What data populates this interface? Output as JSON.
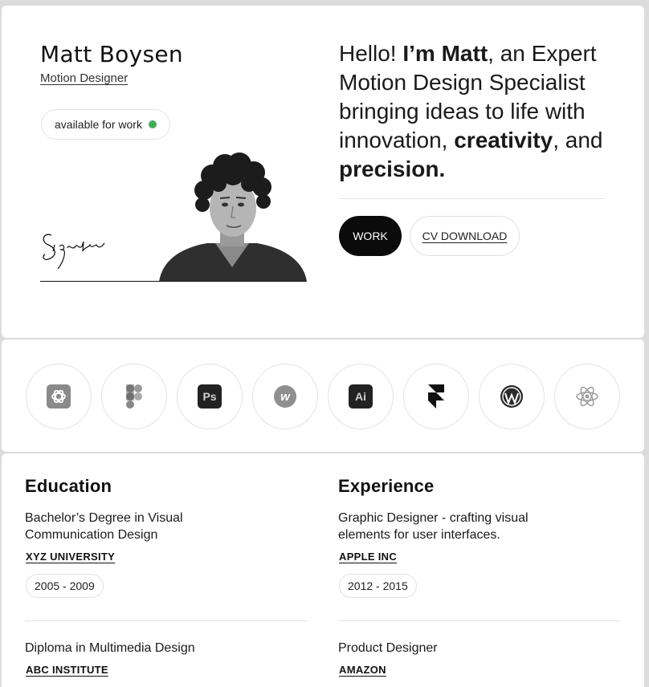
{
  "profile": {
    "name": "Matt Boysen",
    "role": "Motion Designer",
    "availability": "available for work",
    "status_color": "#3fae57"
  },
  "headline": {
    "p1": "Hello! ",
    "b1": "I’m Matt",
    "p2": ", an Expert Motion Design Specialist bringing ideas to life with innovation, ",
    "b2": "creativity",
    "p3": ", and ",
    "b3": "precision."
  },
  "actions": {
    "work_label": "WORK",
    "cv_label": "CV DOWNLOAD"
  },
  "tools": [
    {
      "icon": "chatgpt-icon"
    },
    {
      "icon": "figma-icon"
    },
    {
      "icon": "photoshop-icon",
      "label": "Ps"
    },
    {
      "icon": "webflow-icon",
      "label": "w"
    },
    {
      "icon": "illustrator-icon",
      "label": "Ai"
    },
    {
      "icon": "framer-icon"
    },
    {
      "icon": "wordpress-icon"
    },
    {
      "icon": "react-icon"
    }
  ],
  "education": {
    "title": "Education",
    "items": [
      {
        "degree": "Bachelor’s Degree in Visual Communication Design",
        "org": "XYZ UNIVERSITY",
        "years": "2005 - 2009"
      },
      {
        "degree": "Diploma in Multimedia Design",
        "org": "ABC INSTITUTE"
      }
    ]
  },
  "experience": {
    "title": "Experience",
    "items": [
      {
        "degree": "Graphic Designer - crafting visual elements for user interfaces.",
        "org": "APPLE INC",
        "years": "2012 - 2015"
      },
      {
        "degree": "Product Designer",
        "org": "AMAZON"
      }
    ]
  }
}
